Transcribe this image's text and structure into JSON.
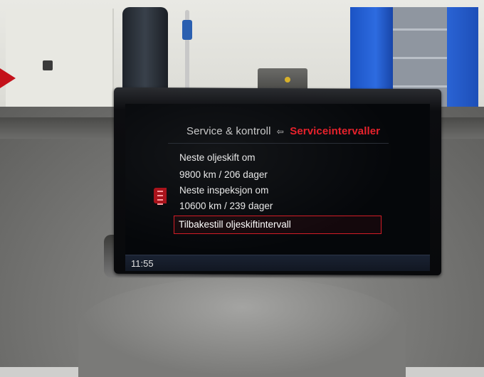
{
  "screen": {
    "breadcrumb_parent": "Service & kontroll",
    "breadcrumb_current": "Serviceintervaller",
    "items": [
      {
        "label": "Neste oljeskift om",
        "value": "9800 km / 206 dager"
      },
      {
        "label": "Neste inspeksjon om",
        "value": "10600 km / 239 dager"
      }
    ],
    "selected_action": "Tilbakestill oljeskiftintervall",
    "clock": "11:55"
  },
  "icons": {
    "breadcrumb_separator": "return-arrow-icon",
    "scroll": "scroll-indicator-icon"
  },
  "colors": {
    "accent": "#e8222c",
    "screen_bg": "#05070a",
    "statusbar_bg": "#1a2232"
  }
}
